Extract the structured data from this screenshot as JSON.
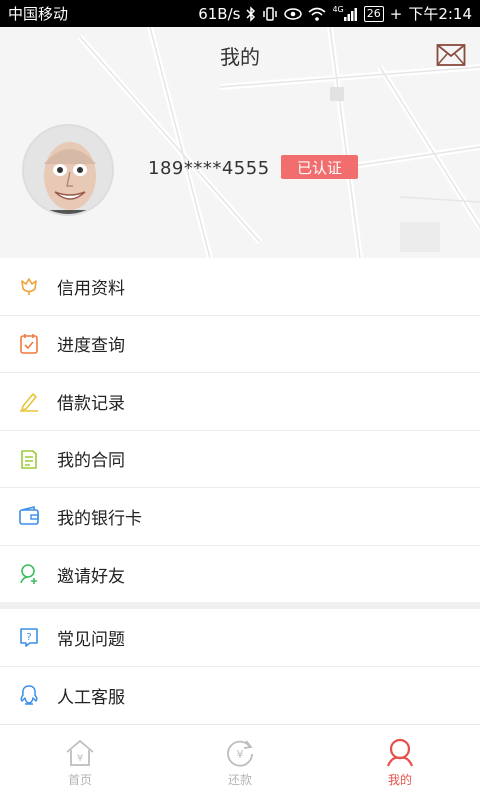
{
  "status_bar": {
    "carrier": "中国移动",
    "speed": "61B/s",
    "network": "4G",
    "battery": "26",
    "time": "下午2:14"
  },
  "header": {
    "title": "我的",
    "phone": "189****4555",
    "verified_badge": "已认证"
  },
  "menu": [
    {
      "label": "信用资料",
      "icon": "tulip-icon",
      "color": "#f0a23b"
    },
    {
      "label": "进度查询",
      "icon": "progress-doc-icon",
      "color": "#f07b3b"
    },
    {
      "label": "借款记录",
      "icon": "pencil-icon",
      "color": "#e8c43a"
    },
    {
      "label": "我的合同",
      "icon": "contract-icon",
      "color": "#9ccc3b"
    },
    {
      "label": "我的银行卡",
      "icon": "wallet-icon",
      "color": "#3b8fe8"
    },
    {
      "label": "邀请好友",
      "icon": "invite-user-icon",
      "color": "#3bbf62"
    }
  ],
  "menu2": [
    {
      "label": "常见问题",
      "icon": "question-icon",
      "color": "#3b8fe8"
    },
    {
      "label": "人工客服",
      "icon": "qq-icon",
      "color": "#3b8fe8"
    }
  ],
  "tabs": [
    {
      "label": "首页",
      "icon": "home-icon",
      "active": false
    },
    {
      "label": "还款",
      "icon": "repay-icon",
      "active": false
    },
    {
      "label": "我的",
      "icon": "user-icon",
      "active": true
    }
  ],
  "colors": {
    "accent": "#e8504d",
    "badge": "#f26e6e"
  }
}
